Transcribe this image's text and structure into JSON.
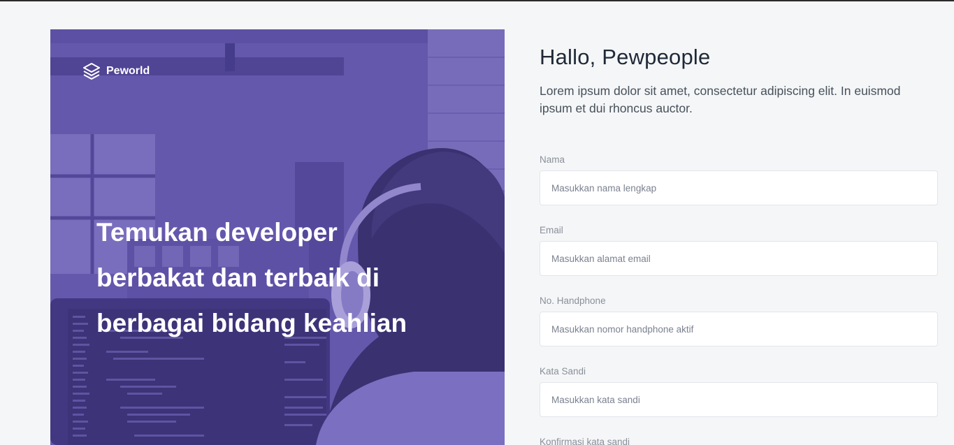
{
  "brand": {
    "name": "Peworld",
    "logo_icon": "layers-icon"
  },
  "hero": {
    "headline": "Temukan developer berbakat dan terbaik di berbagai bidang keahlian",
    "overlay_color": "#5e51a3"
  },
  "form": {
    "greeting": "Hallo, Pewpeople",
    "intro": "Lorem ipsum dolor sit amet, consectetur adipiscing elit. In euismod ipsum et dui rhoncus auctor.",
    "fields": [
      {
        "label": "Nama",
        "placeholder": "Masukkan nama lengkap"
      },
      {
        "label": "Email",
        "placeholder": "Masukkan alamat email"
      },
      {
        "label": "No. Handphone",
        "placeholder": "Masukkan nomor handphone aktif"
      },
      {
        "label": "Kata Sandi",
        "placeholder": "Masukkan kata sandi"
      },
      {
        "label": "Konfirmasi kata sandi",
        "placeholder": ""
      }
    ]
  }
}
